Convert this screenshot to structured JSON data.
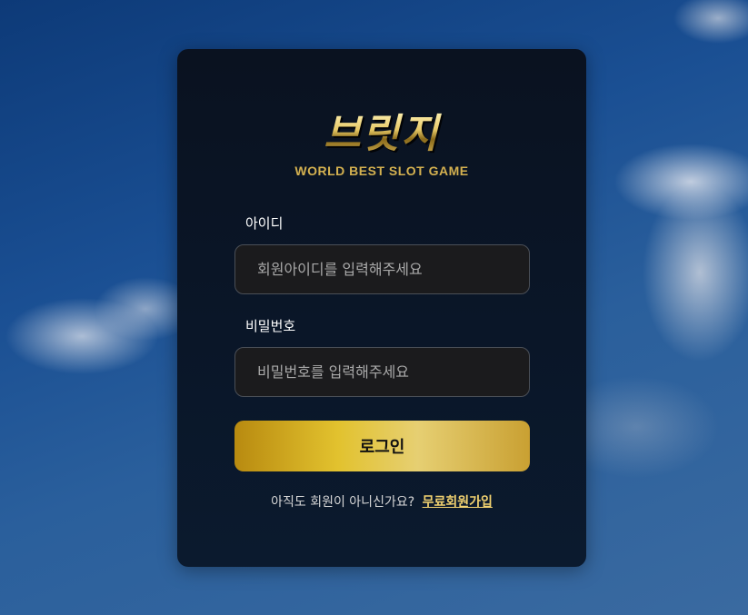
{
  "logo": {
    "title": "브릿지",
    "subtitle": "WORLD BEST SLOT GAME"
  },
  "form": {
    "id_label": "아이디",
    "id_placeholder": "회원아이디를 입력해주세요",
    "id_value": "",
    "password_label": "비밀번호",
    "password_placeholder": "비밀번호를 입력해주세요",
    "password_value": "",
    "login_label": "로그인"
  },
  "signup": {
    "prompt": "아직도 회원이 아니신가요?",
    "link_label": "무료회원가입"
  },
  "colors": {
    "accent_gold": "#e2c22e",
    "link_gold": "#f2d270",
    "card_bg": "#0a1628"
  }
}
